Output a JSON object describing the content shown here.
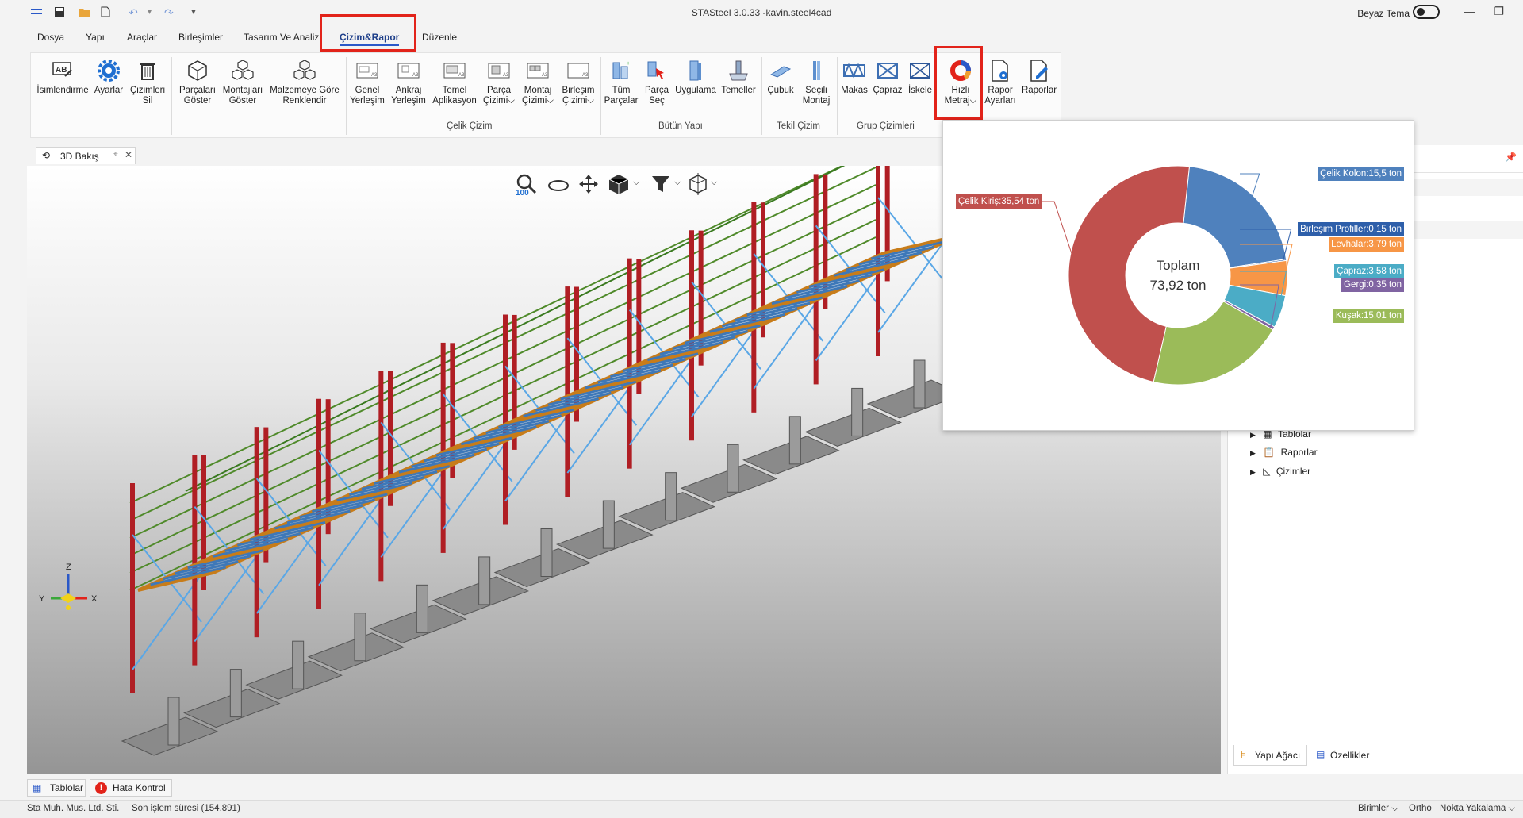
{
  "window": {
    "title": "STASteel 3.0.33 -kavin.steel4cad",
    "theme_label": "Beyaz Tema"
  },
  "menu": {
    "tabs": [
      "Dosya",
      "Yapı",
      "Araçlar",
      "Birleşimler",
      "Tasarım Ve Analiz",
      "Çizim&Rapor",
      "Düzenle"
    ],
    "active": "Çizim&Rapor"
  },
  "ribbon": {
    "buttons": {
      "isimlendirme": "İsimlendirme",
      "ayarlar": "Ayarlar",
      "cizimleri_sil_1": "Çizimleri",
      "cizimleri_sil_2": "Sil",
      "parcalari_goster_1": "Parçaları",
      "parcalari_goster_2": "Göster",
      "montajlari_goster_1": "Montajları",
      "montajlari_goster_2": "Göster",
      "malzemeye_1": "Malzemeye Göre",
      "malzemeye_2": "Renklendir",
      "genel_1": "Genel",
      "genel_2": "Yerleşim",
      "ankraj_1": "Ankraj",
      "ankraj_2": "Yerleşim",
      "temel_1": "Temel",
      "temel_2": "Aplikasyon",
      "parca_1": "Parça",
      "parca_2": "Çizimi",
      "montaj_1": "Montaj",
      "montaj_2": "Çizimi",
      "birlesim_1": "Birleşim",
      "birlesim_2": "Çizimi",
      "tum_1": "Tüm",
      "tum_2": "Parçalar",
      "parcasec_1": "Parça",
      "parcasec_2": "Seç",
      "uygulama": "Uygulama",
      "temeller": "Temeller",
      "cubuk": "Çubuk",
      "secili_1": "Seçili",
      "secili_2": "Montaj",
      "makas": "Makas",
      "capraz": "Çapraz",
      "iskele": "İskele",
      "hizli_1": "Hızlı",
      "hizli_2": "Metraj",
      "rapor_1": "Rapor",
      "rapor_2": "Ayarları",
      "raporlar": "Raporlar"
    },
    "groups": {
      "celik_cizim": "Çelik Çizim",
      "butun_yapi": "Bütün Yapı",
      "tekil_cizim": "Tekil Çizim",
      "grup_cizimleri": "Grup Çizimleri"
    }
  },
  "view": {
    "tab_label": "3D Bakış",
    "zoom_level": "100",
    "axes": {
      "x": "X",
      "y": "Y",
      "z": "Z"
    }
  },
  "tree": {
    "items": [
      "Tablolar",
      "Raporlar",
      "Çizimler"
    ]
  },
  "right_tabs": {
    "tree": "Yapı Ağacı",
    "props": "Özellikler"
  },
  "chart_data": {
    "type": "pie",
    "donut": true,
    "center_label": "Toplam",
    "center_value": "73,92 ton",
    "unit": "ton",
    "slices": [
      {
        "label": "Çelik Kolon:15,5 ton",
        "value": 15.5,
        "color": "#4f81bd"
      },
      {
        "label": "Birleşim Profiller:0,15 ton",
        "value": 0.15,
        "color": "#2e5faa"
      },
      {
        "label": "Levhalar:3,79 ton",
        "value": 3.79,
        "color": "#f79646"
      },
      {
        "label": "Çapraz:3,58 ton",
        "value": 3.58,
        "color": "#4bacc6"
      },
      {
        "label": "Gergi:0,35 ton",
        "value": 0.35,
        "color": "#8064a2"
      },
      {
        "label": "Kuşak:15,01 ton",
        "value": 15.01,
        "color": "#9bbb59"
      },
      {
        "label": "Çelik Kiriş:35,54 ton",
        "value": 35.54,
        "color": "#c0504d"
      }
    ]
  },
  "bottom_tabs": {
    "tablolar": "Tablolar",
    "hata": "Hata Kontrol"
  },
  "status": {
    "company": "Sta Muh. Mus. Ltd. Sti.",
    "last_op": "Son işlem süresi (154,891)",
    "units": "Birimler",
    "ortho": "Ortho",
    "snap": "Nokta Yakalama"
  }
}
